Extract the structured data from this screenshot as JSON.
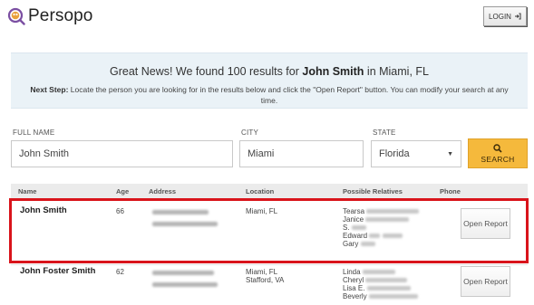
{
  "header": {
    "brand": "Persopo",
    "login_label": "LOGIN",
    "login_icon": "sign-in-icon"
  },
  "banner": {
    "headline_pre": "Great News! We found 100 results for ",
    "headline_name": "John Smith",
    "headline_post": " in Miami, FL",
    "next_step_label": "Next Step:",
    "next_step_text": " Locate the person you are looking for in the results below and click the \"Open Report\" button. You can modify your search at any time."
  },
  "search": {
    "full_name_label": "FULL NAME",
    "full_name_value": "John Smith",
    "city_label": "CITY",
    "city_value": "Miami",
    "state_label": "STATE",
    "state_value": "Florida",
    "search_label": "SEARCH",
    "search_icon": "search-icon"
  },
  "table": {
    "columns": [
      "Name",
      "Age",
      "Address",
      "Location",
      "Possible Relatives",
      "Phone"
    ],
    "rows": [
      {
        "name": "John Smith",
        "age": "66",
        "location_1": "Miami, FL",
        "location_2": "",
        "relatives": [
          "Tearsa",
          "Janice",
          "S.",
          "Edward",
          "Gary"
        ],
        "open_label": "Open Report",
        "highlighted": true
      },
      {
        "name": "John Foster Smith",
        "age": "62",
        "location_1": "Miami, FL",
        "location_2": "Stafford, VA",
        "relatives": [
          "Linda",
          "Cheryl",
          "Lisa E.",
          "Beverly"
        ],
        "open_label": "Open Report",
        "highlighted": false
      }
    ]
  },
  "colors": {
    "accent": "#f5b93c",
    "highlight_border": "#d9141b",
    "banner_bg": "#eaf2f7",
    "logo_ring": "#7b4fa2"
  }
}
